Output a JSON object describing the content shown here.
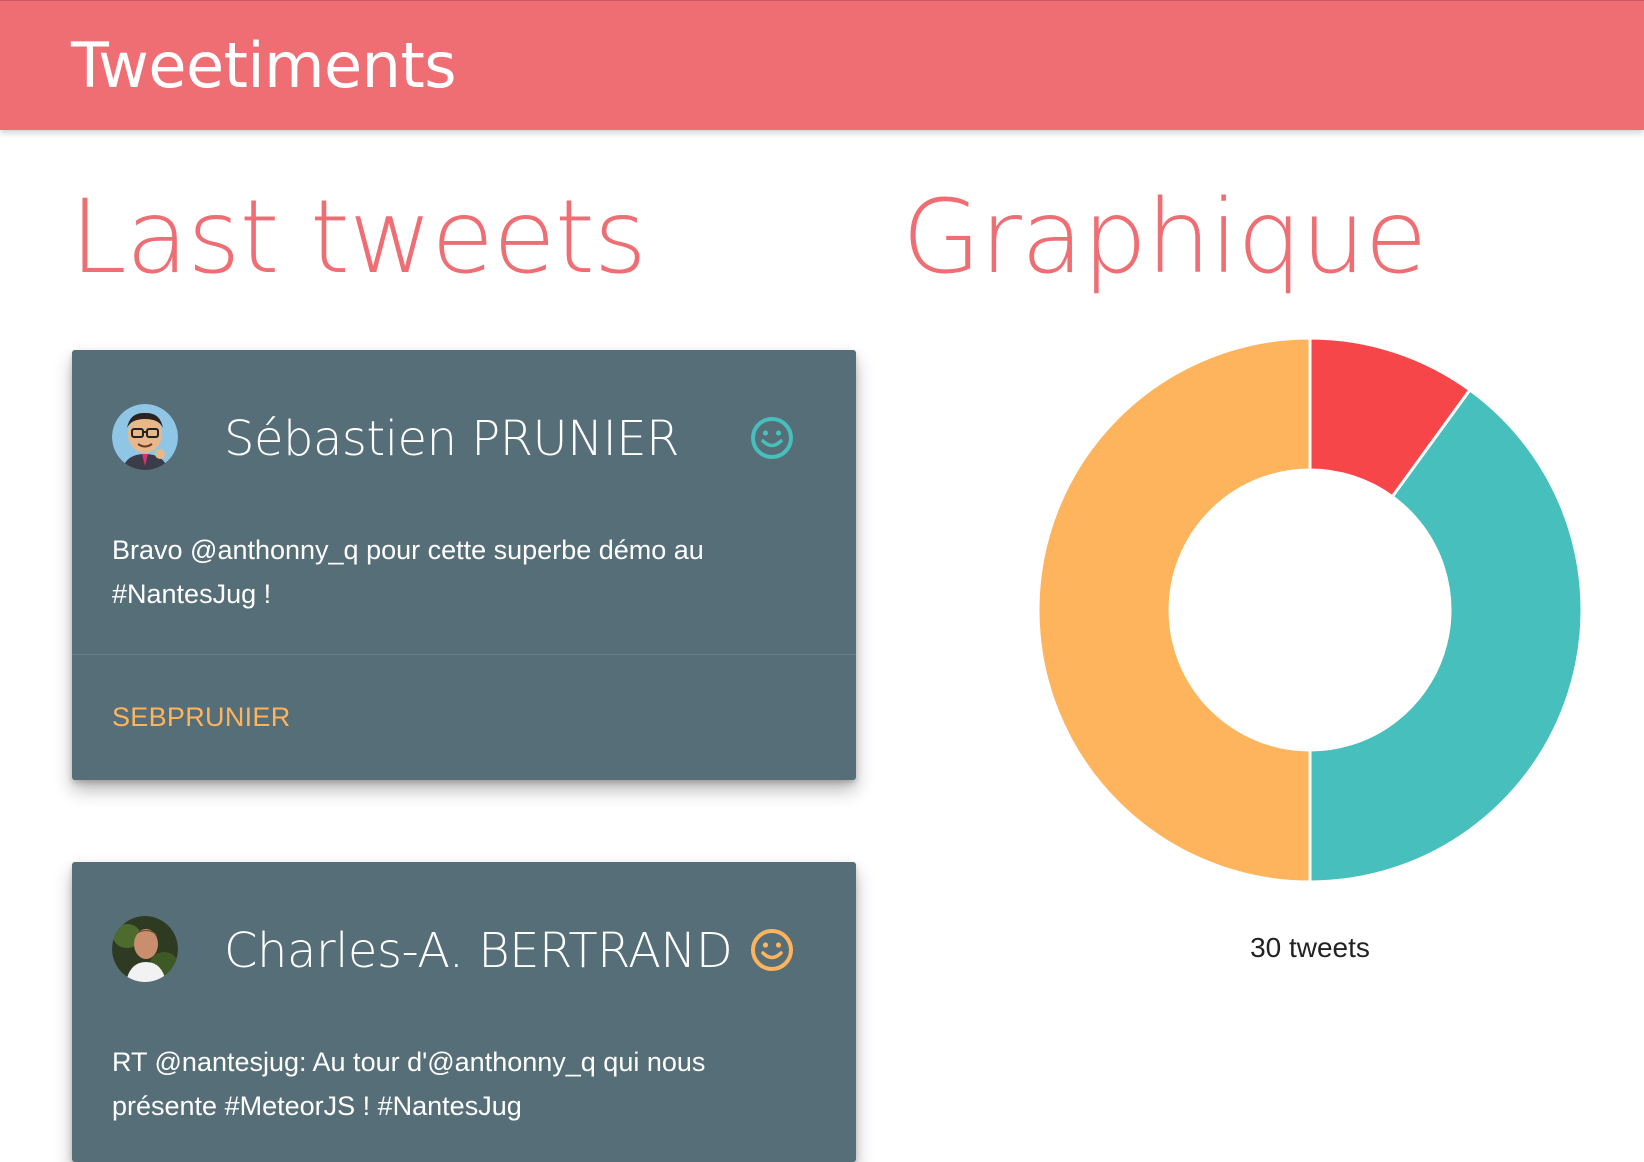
{
  "app": {
    "brand": "Tweetiments"
  },
  "sections": {
    "tweets_title": "Last tweets",
    "graph_title": "Graphique"
  },
  "tweets": [
    {
      "author": "Sébastien PRUNIER",
      "text": "Bravo @anthonny_q pour cette superbe démo au #NantesJug !",
      "handle": "SEBPRUNIER",
      "mood": "happy",
      "mood_color": "#46bfbd",
      "avatar_icon": "cartoon-avatar-icon"
    },
    {
      "author": "Charles-A. BERTRAND",
      "text": "RT @nantesjug: Au tour d'@anthonny_q qui nous présente #MeteorJS ! #NantesJug",
      "handle": "",
      "mood": "happy",
      "mood_color": "#fdb45c",
      "avatar_icon": "photo-avatar-icon"
    }
  ],
  "colors": {
    "header": "#ef6e74",
    "card": "#566e78",
    "handle": "#fdb45c",
    "positive": "#46bfbd",
    "negative": "#f7464a",
    "neutral": "#fdb45c"
  },
  "chart_data": {
    "type": "pie",
    "title": "",
    "caption": "30 tweets",
    "total": 30,
    "series": [
      {
        "value": 3,
        "color": "#f7464a"
      },
      {
        "value": 12,
        "color": "#46bfbd"
      },
      {
        "value": 15,
        "color": "#fdb45c"
      }
    ]
  }
}
